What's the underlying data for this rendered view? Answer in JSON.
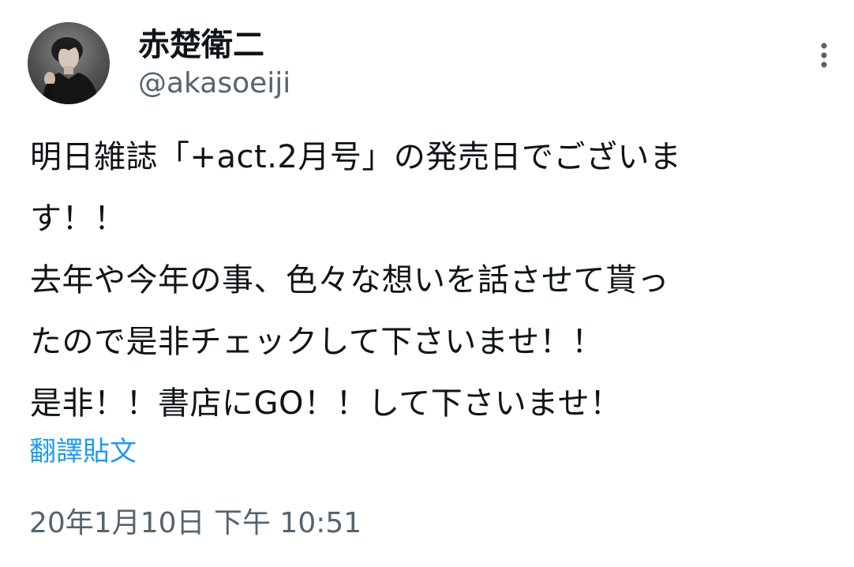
{
  "author": {
    "display_name": "赤楚衛二",
    "handle": "@akasoeiji",
    "avatar_icon": "user-avatar-photo"
  },
  "menu": {
    "icon": "more-vertical-icon"
  },
  "tweet": {
    "lines": [
      "明日雑誌「+act.2月号」の発売日でございま",
      "す！！",
      "去年や今年の事、色々な想いを話させて貰っ",
      "たので是非チェックして下さいませ！！",
      "是非！！書店にGO！！して下さいませ！"
    ]
  },
  "translate": {
    "label": "翻譯貼文"
  },
  "meta": {
    "timestamp": "20年1月10日 下午 10:51"
  },
  "colors": {
    "text": "#0f1419",
    "secondary": "#536471",
    "link": "#1d9bf0"
  }
}
